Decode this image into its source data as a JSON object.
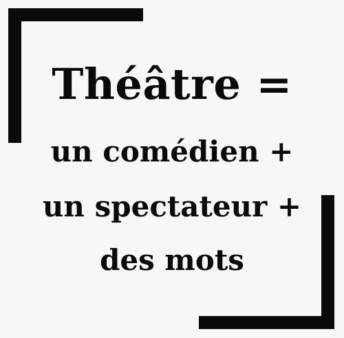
{
  "quote": {
    "line1": "Théâtre =",
    "line2": "un comédien +",
    "line3": "un spectateur +",
    "line4": "des mots"
  },
  "colors": {
    "background": "#f7f7f7",
    "ink": "#0a0a0a"
  }
}
